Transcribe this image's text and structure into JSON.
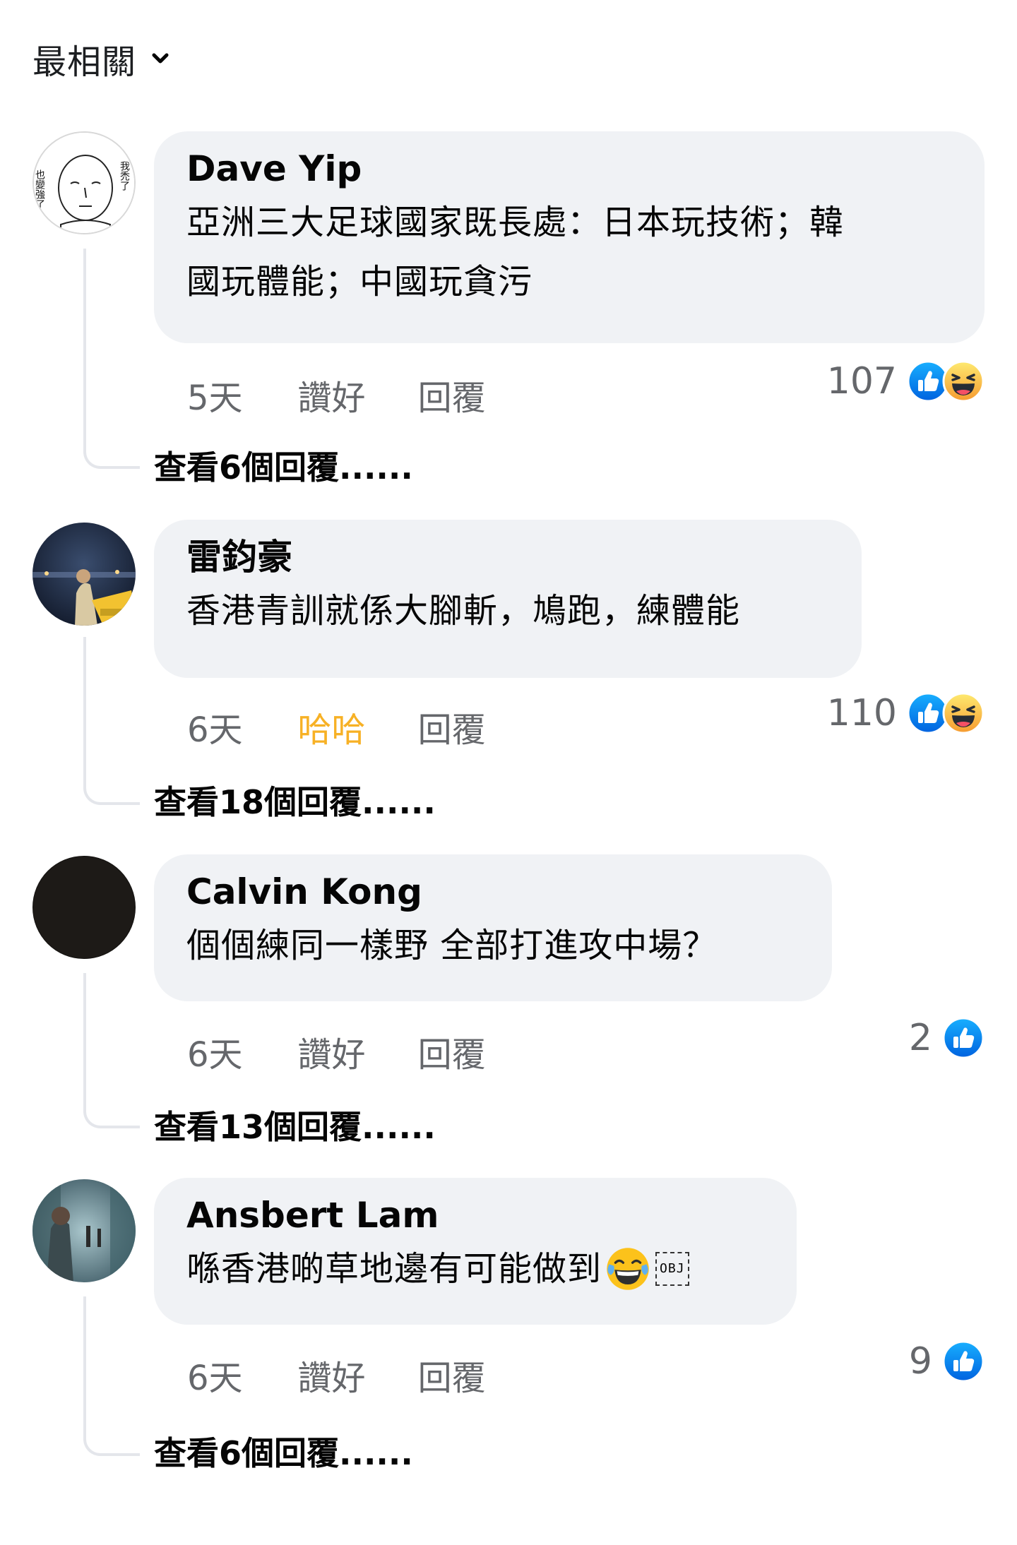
{
  "sort": {
    "label": "最相關"
  },
  "comments": [
    {
      "author": "Dave Yip",
      "lines": [
        "亞洲三大足球國家既長處：日本玩技術；韓",
        "國玩體能；中國玩貪污"
      ],
      "time": "5天",
      "like_label": "讚好",
      "reply_label": "回覆",
      "reaction_count": "107",
      "reactions": [
        "like-icon",
        "haha-icon"
      ],
      "view_replies": "查看6個回覆......",
      "avatar_text_left": "也變強了",
      "avatar_text_right": "我禿了"
    },
    {
      "author": "雷鈞豪",
      "lines": [
        "香港青訓就係大腳斬，鳩跑，練體能"
      ],
      "time": "6天",
      "like_label": "哈哈",
      "reply_label": "回覆",
      "reaction_count": "110",
      "reactions": [
        "like-icon",
        "haha-icon"
      ],
      "view_replies": "查看18個回覆......"
    },
    {
      "author": "Calvin Kong",
      "lines": [
        "個個練同一樣野 全部打進攻中場？"
      ],
      "time": "6天",
      "like_label": "讚好",
      "reply_label": "回覆",
      "reaction_count": "2",
      "reactions": [
        "like-icon"
      ],
      "view_replies": "查看13個回覆......"
    },
    {
      "author": "Ansbert Lam",
      "lines": [
        "喺香港啲草地邊有可能做到"
      ],
      "emoji": "laugh-tears-icon",
      "obj_text": "OBJ",
      "time": "6天",
      "like_label": "讚好",
      "reply_label": "回覆",
      "reaction_count": "9",
      "reactions": [
        "like-icon"
      ],
      "view_replies": "查看6個回覆......"
    }
  ],
  "colors": {
    "bubble": "#f0f2f5",
    "meta": "#65676b",
    "haha": "#f7b125",
    "like_blue": "#1877f2",
    "thread_line": "#e4e6eb"
  }
}
